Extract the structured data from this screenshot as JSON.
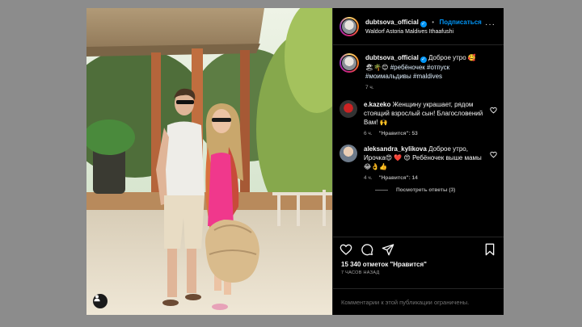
{
  "post": {
    "author": "dubtsova_official",
    "follow_label": "Подписаться",
    "separator": "•",
    "location": "Waldorf Astoria Maldives Ithaafushi",
    "more_glyph": "···"
  },
  "caption": {
    "author": "dubtsova_official",
    "text_1": " Доброе утро 🥰",
    "text_2": "🏖🌴😊 ",
    "tag_1": "#ребёночек",
    "tag_2": "#отпуск",
    "tag_3": "#моимальдивы",
    "tag_4": "#maldives",
    "time": "7 ч."
  },
  "comments": [
    {
      "author": "e.kazeko",
      "text": " Женщину украшает, рядом стоящий взрослый сын! Благословений Вам! 🙌",
      "time": "6 ч.",
      "likes": "\"Нравится\": 53"
    },
    {
      "author": "aleksandra_kylikova",
      "text": " Доброе утро, Ирочка😍 ❤️ 😍 Ребёночек выше мамы😂👌👍",
      "time": "4 ч.",
      "likes": "\"Нравится\": 14",
      "replies": "Посмотреть ответы (3)"
    }
  ],
  "stats": {
    "likes": "15 340 отметок \"Нравится\"",
    "ago": "7 ЧАСОВ НАЗАД"
  },
  "footer": {
    "comments_limited": "Комментарии к этой публикации ограничены."
  },
  "colors": {
    "accent": "#0095f6",
    "background": "#000000",
    "overlay": "#8c8c8c",
    "secondary_text": "#a8a8a8"
  },
  "icons": [
    "verified-icon",
    "more-icon",
    "heart-icon",
    "comment-icon",
    "share-icon",
    "bookmark-icon",
    "user-tag-icon"
  ]
}
